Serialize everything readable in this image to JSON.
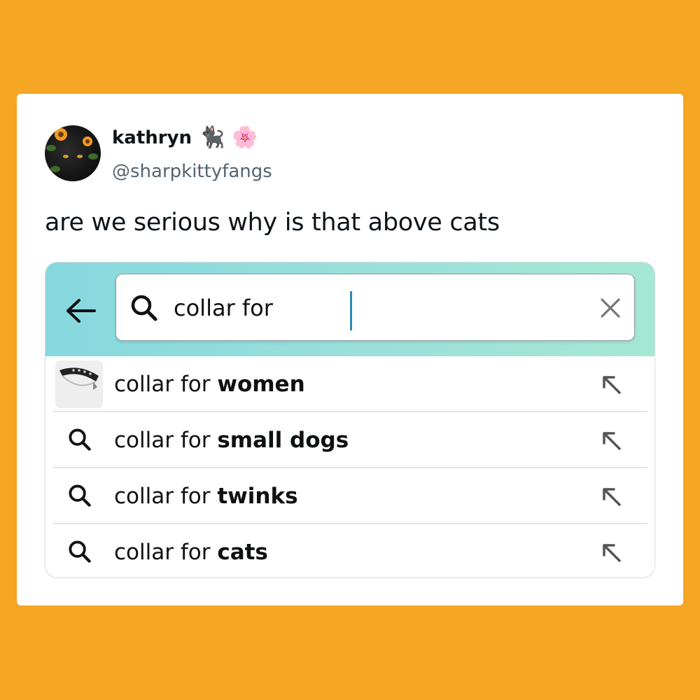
{
  "tweet": {
    "display_name": "kathryn",
    "name_emojis": [
      "🐈‍⬛",
      "🌸"
    ],
    "handle": "@sharpkittyfangs",
    "text": "are we serious why is that above cats"
  },
  "search": {
    "value": "collar for",
    "icons": {
      "back": "back-arrow-icon",
      "search": "search-icon",
      "clear": "close-icon"
    }
  },
  "suggestions": [
    {
      "prefix": "collar for ",
      "completion": "women",
      "icon": "product-thumbnail"
    },
    {
      "prefix": "collar for ",
      "completion": "small dogs",
      "icon": "search-icon"
    },
    {
      "prefix": "collar for ",
      "completion": "twinks",
      "icon": "search-icon"
    },
    {
      "prefix": "collar for ",
      "completion": "cats",
      "icon": "search-icon"
    }
  ],
  "colors": {
    "background": "#F5A623",
    "header_gradient_start": "#86d8df",
    "header_gradient_end": "#a5e8d3",
    "caret": "#2a8ab8"
  }
}
